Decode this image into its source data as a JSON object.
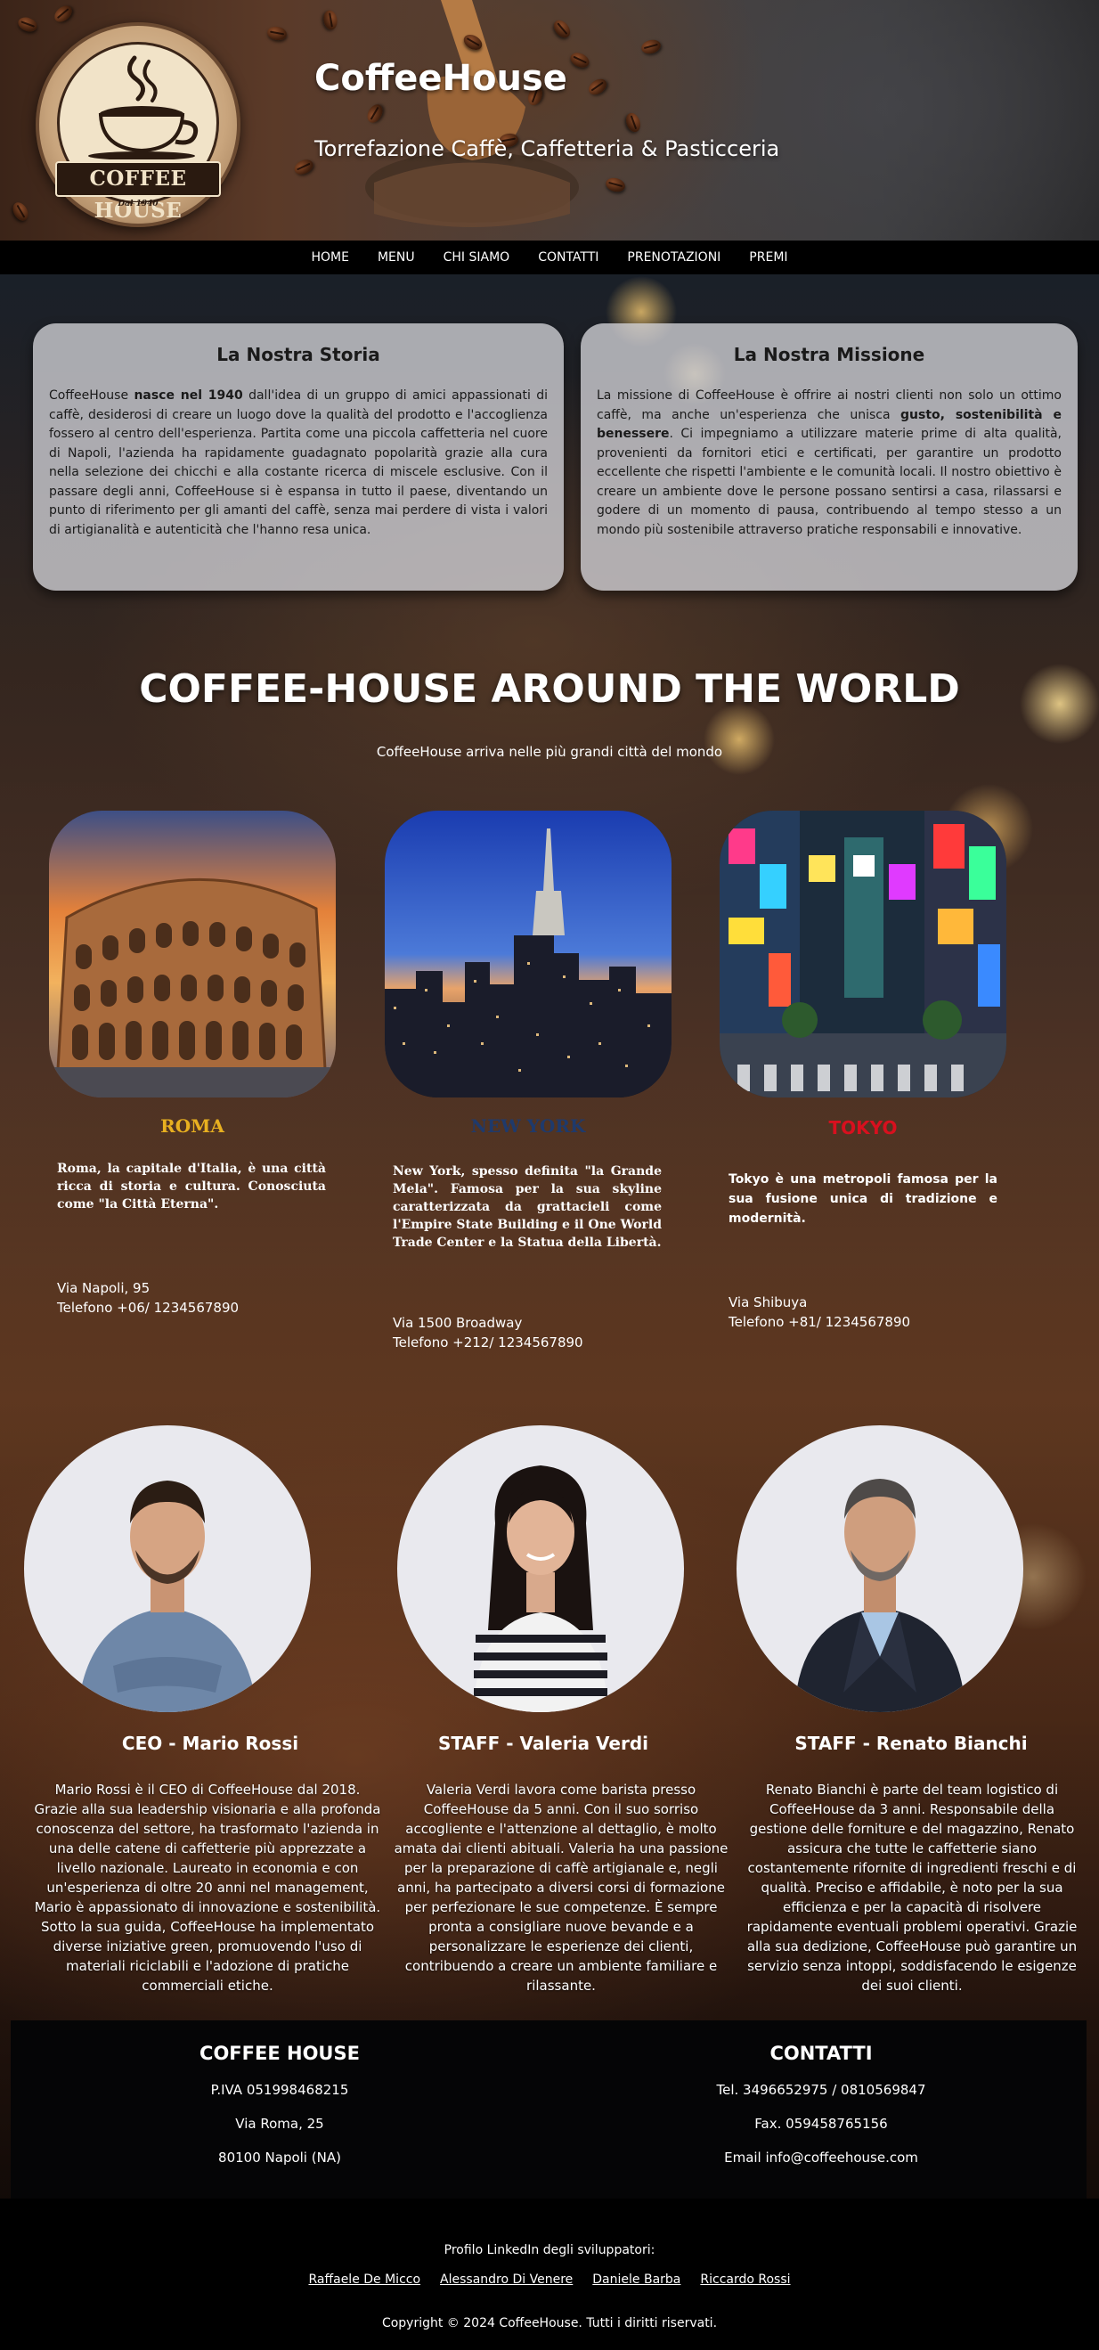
{
  "header": {
    "logo_text": "COFFEE HOUSE",
    "logo_year": "Dal 1940",
    "title": "CoffeeHouse",
    "subtitle": "Torrefazione Caffè, Caffetteria & Pasticceria"
  },
  "nav": {
    "items": [
      "HOME",
      "MENU",
      "CHI SIAMO",
      "CONTATTI",
      "PRENOTAZIONI",
      "PREMI"
    ]
  },
  "storia": {
    "title": "La Nostra Storia",
    "text_before": "CoffeeHouse ",
    "text_bold": "nasce nel 1940",
    "text_after": " dall'idea di un gruppo di amici appassionati di caffè, desiderosi di creare un luogo dove la qualità del prodotto e l'accoglienza fossero al centro dell'esperienza. Partita come una piccola caffetteria nel cuore di Napoli, l'azienda ha rapidamente guadagnato popolarità grazie alla cura nella selezione dei chicchi e alla costante ricerca di miscele esclusive. Con il passare degli anni, CoffeeHouse si è espansa in tutto il paese, diventando un punto di riferimento per gli amanti del caffè, senza mai perdere di vista i valori di artigianalità e autenticità che l'hanno resa unica."
  },
  "missione": {
    "title": "La Nostra Missione",
    "text_before": "La missione di CoffeeHouse è offrire ai nostri clienti non solo un ottimo caffè, ma anche un'esperienza che unisca ",
    "text_bold": "gusto, sostenibilità e benessere",
    "text_after": ". Ci impegniamo a utilizzare materie prime di alta qualità, provenienti da fornitori etici e certificati, per garantire un prodotto eccellente che rispetti l'ambiente e le comunità locali. Il nostro obiettivo è creare un ambiente dove le persone possano sentirsi a casa, rilassarsi e godere di un momento di pausa, contribuendo al tempo stesso a un mondo più sostenibile attraverso pratiche responsabili e innovative."
  },
  "world": {
    "title": "COFFEE-HOUSE AROUND THE WORLD",
    "subtitle": "CoffeeHouse arriva nelle più grandi città del mondo",
    "cities": [
      {
        "name": "ROMA",
        "color": "#e8b020",
        "description": "Roma, la capitale d'Italia, è una città ricca di storia e cultura. Conosciuta come \"la Città Eterna\".",
        "address": "Via Napoli, 95",
        "phone": "Telefono +06/ 1234567890"
      },
      {
        "name": "NEW YORK",
        "color": "#1f3a6b",
        "description": "New York, spesso definita \"la Grande Mela\". Famosa per la sua skyline caratterizzata da grattacieli come l'Empire State Building e il One World Trade Center e la Statua della Libertà.",
        "address": "Via 1500 Broadway",
        "phone": "Telefono +212/ 1234567890"
      },
      {
        "name": "TOKYO",
        "color": "#d8101e",
        "description": "Tokyo è una metropoli famosa per la sua fusione unica di tradizione e modernità.",
        "address": "Via Shibuya",
        "phone": "Telefono +81/ 1234567890"
      }
    ]
  },
  "team": [
    {
      "role": "CEO - Mario Rossi",
      "description": "Mario Rossi è il CEO di CoffeeHouse dal 2018. Grazie alla sua leadership visionaria e alla profonda conoscenza del settore, ha trasformato l'azienda in una delle catene di caffetterie più apprezzate a livello nazionale. Laureato in economia e con un'esperienza di oltre 20 anni nel management, Mario è appassionato di innovazione e sostenibilità. Sotto la sua guida, CoffeeHouse ha implementato diverse iniziative green, promuovendo l'uso di materiali riciclabili e l'adozione di pratiche commerciali etiche."
    },
    {
      "role": "STAFF - Valeria Verdi",
      "description": "Valeria Verdi lavora come barista presso CoffeeHouse da 5 anni. Con il suo sorriso accogliente e l'attenzione al dettaglio, è molto amata dai clienti abituali. Valeria ha una passione per la preparazione di caffè artigianale e, negli anni, ha partecipato a diversi corsi di formazione per perfezionare le sue competenze. È sempre pronta a consigliare nuove bevande e a personalizzare le esperienze dei clienti, contribuendo a creare un ambiente familiare e rilassante."
    },
    {
      "role": "STAFF - Renato Bianchi",
      "description": "Renato Bianchi è parte del team logistico di CoffeeHouse da 3 anni. Responsabile della gestione delle forniture e del magazzino, Renato assicura che tutte le caffetterie siano costantemente rifornite di ingredienti freschi e di qualità. Preciso e affidabile, è noto per la sua efficienza e per la capacità di risolvere rapidamente eventuali problemi operativi. Grazie alla sua dedizione, CoffeeHouse può garantire un servizio senza intoppi, soddisfacendo le esigenze dei suoi clienti."
    }
  ],
  "footer": {
    "company": {
      "title": "COFFEE HOUSE",
      "piva": "P.IVA 051998468215",
      "street": "Via Roma, 25",
      "city": "80100 Napoli (NA)"
    },
    "contacts": {
      "title": "CONTATTI",
      "tel": "Tel. 3496652975 / 0810569847",
      "fax": "Fax. 059458765156",
      "email": "Email info@coffeehouse.com"
    },
    "dev_label": "Profilo LinkedIn degli sviluppatori:",
    "developers": [
      "Raffaele De Micco",
      "Alessandro Di Venere",
      "Daniele Barba",
      "Riccardo Rossi"
    ],
    "copyright": "Copyright © 2024 CoffeeHouse. Tutti i diritti riservati."
  }
}
